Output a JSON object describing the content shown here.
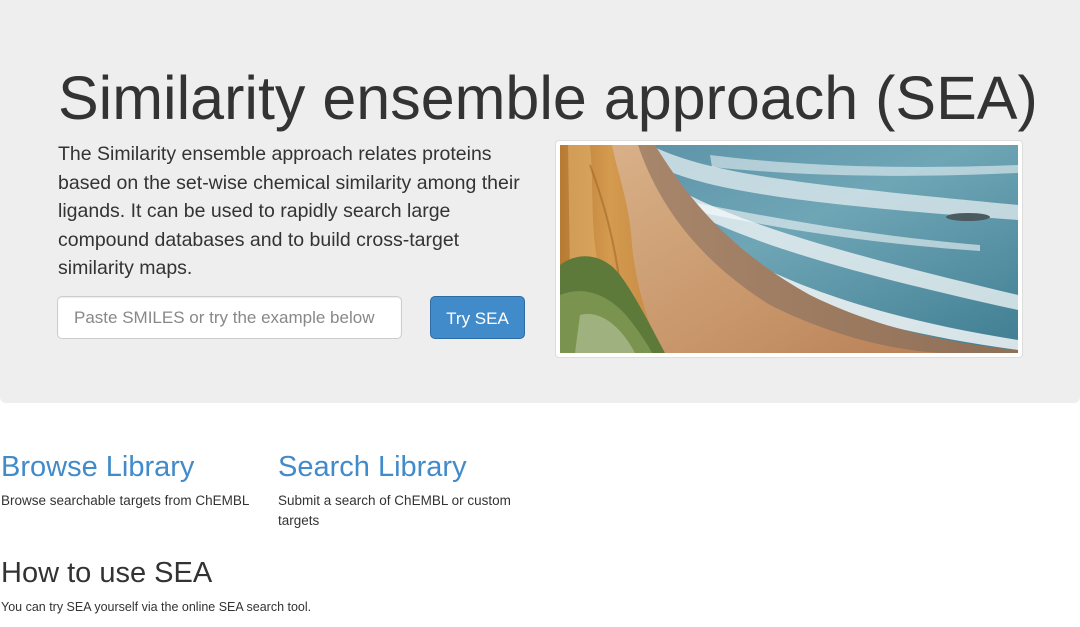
{
  "hero": {
    "title": "Similarity ensemble approach (SEA)",
    "description": "The Similarity ensemble approach relates proteins based on the set-wise chemical similarity among their ligands. It can be used to rapidly search large compound databases and to build cross-target similarity maps.",
    "search_placeholder": "Paste SMILES or try the example below",
    "search_value": "",
    "try_button_label": "Try SEA",
    "image_icon": "coastline-photo"
  },
  "features": [
    {
      "title": "Browse Library",
      "description": "Browse searchable targets from ChEMBL"
    },
    {
      "title": "Search Library",
      "description": "Submit a search of ChEMBL or custom targets"
    }
  ],
  "howto": {
    "title": "How to use SEA",
    "text": "You can try SEA yourself via the online SEA search tool."
  },
  "colors": {
    "jumbotron_bg": "#eeeeee",
    "link": "#428bca",
    "primary_button": "#428bca",
    "text": "#333333"
  }
}
